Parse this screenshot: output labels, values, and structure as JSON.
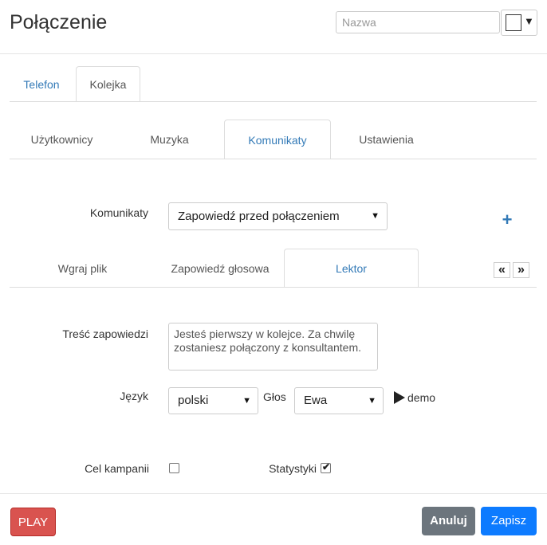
{
  "header": {
    "title": "Połączenie",
    "name_placeholder": "Nazwa",
    "color_icon": "color-swatch-icon",
    "caret_icon": "chevron-down-icon"
  },
  "tabs_level1": [
    {
      "label": "Telefon",
      "active": false
    },
    {
      "label": "Kolejka",
      "active": true
    }
  ],
  "tabs_level2": [
    {
      "label": "Użytkownicy",
      "active": false
    },
    {
      "label": "Muzyka",
      "active": false
    },
    {
      "label": "Komunikaty",
      "active": true
    },
    {
      "label": "Ustawienia",
      "active": false
    }
  ],
  "komunikaty": {
    "label": "Komunikaty",
    "selected": "Zapowiedź przed połączeniem",
    "add_icon": "plus-icon"
  },
  "tabs_level3": [
    {
      "label": "Wgraj plik",
      "active": false
    },
    {
      "label": "Zapowiedź głosowa",
      "active": false
    },
    {
      "label": "Lektor",
      "active": true
    }
  ],
  "nav": {
    "prev_symbol": "«",
    "next_symbol": "»"
  },
  "lektor": {
    "text_label": "Treść zapowiedzi",
    "text_value": "Jesteś pierwszy w kolejce. Za chwilę zostaniesz połączony z konsultantem.",
    "language_label": "Język",
    "language_value": "polski",
    "voice_label": "Głos",
    "voice_value": "Ewa",
    "demo_label": "demo"
  },
  "options": {
    "campaign_label": "Cel kampanii",
    "campaign_checked": false,
    "stats_label": "Statystyki",
    "stats_checked": true
  },
  "footer": {
    "play_label": "PLAY",
    "cancel_label": "Anuluj",
    "save_label": "Zapisz"
  },
  "colors": {
    "link": "#337ab7",
    "play": "#d9534f",
    "cancel": "#6c757d",
    "save": "#0d7bff"
  }
}
